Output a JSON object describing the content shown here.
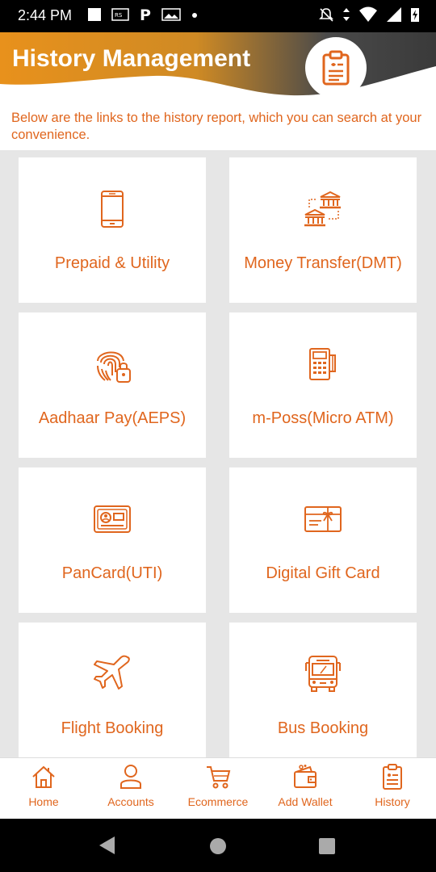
{
  "status_bar": {
    "time": "2:44 PM",
    "left_icons": [
      "notification-square-icon",
      "app-notification-icon",
      "paytm-p-icon",
      "gallery-icon",
      "dot-icon"
    ],
    "right_icons": [
      "mute-icon",
      "data-arrows-icon",
      "wifi-icon",
      "signal-icon",
      "battery-charging-icon"
    ]
  },
  "header": {
    "title": "History Management",
    "badge_icon": "clipboard-history-icon",
    "colors": {
      "orange": "#e8911c",
      "dark": "#3c3c3c"
    }
  },
  "intro_text": "Below are the links to the history report, which you can search at your convenience.",
  "tiles": [
    {
      "label": "Prepaid & Utility",
      "icon": "mobile-phone-icon"
    },
    {
      "label": "Money Transfer(DMT)",
      "icon": "bank-transfer-icon"
    },
    {
      "label": "Aadhaar Pay(AEPS)",
      "icon": "fingerprint-icon"
    },
    {
      "label": "m-Poss(Micro ATM)",
      "icon": "pos-machine-icon"
    },
    {
      "label": "PanCard(UTI)",
      "icon": "id-card-icon"
    },
    {
      "label": "Digital Gift Card",
      "icon": "gift-card-icon"
    },
    {
      "label": "Flight Booking",
      "icon": "airplane-icon"
    },
    {
      "label": "Bus Booking",
      "icon": "bus-icon"
    }
  ],
  "bottom_nav": [
    {
      "label": "Home",
      "icon": "home-icon"
    },
    {
      "label": "Accounts",
      "icon": "user-icon"
    },
    {
      "label": "Ecommerce",
      "icon": "cart-icon"
    },
    {
      "label": "Add Wallet",
      "icon": "wallet-icon"
    },
    {
      "label": "History",
      "icon": "history-clipboard-icon"
    }
  ],
  "system_nav": [
    "back-icon",
    "home-circle-icon",
    "recents-icon"
  ],
  "accent_color": "#e0661e"
}
